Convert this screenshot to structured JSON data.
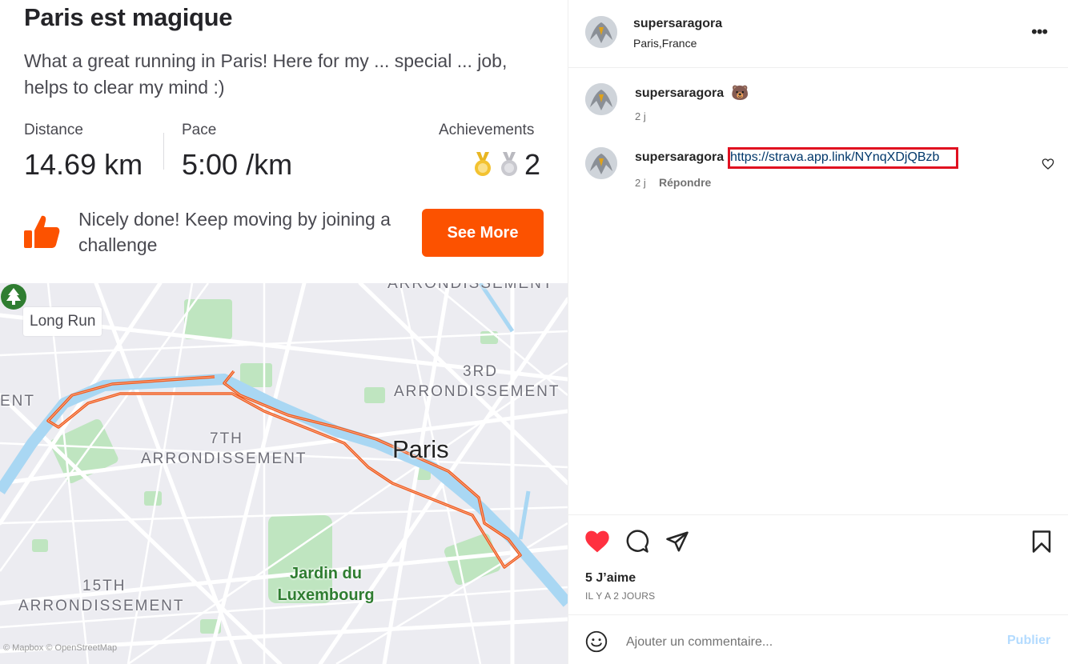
{
  "activity": {
    "title": "Paris est magique",
    "description": "What a great running in Paris! Here for my ... special ... job, helps to clear my mind :)",
    "stats": {
      "distance_label": "Distance",
      "distance_value": "14.69 km",
      "pace_label": "Pace",
      "pace_value": "5:00 /km",
      "achievements_label": "Achievements",
      "achievements_count": "2"
    },
    "promo_text": "Nicely done! Keep moving by joining a challenge",
    "see_more_label": "See More",
    "accent_color": "#fc5200"
  },
  "map": {
    "badge": "Long Run",
    "labels": {
      "arr_top": "ARRONDISSEMENT",
      "arr3_num": "3RD",
      "arr3": "ARRONDISSEMENT",
      "arr_left": "ENT",
      "arr7_num": "7TH",
      "arr7": "ARRONDISSEMENT",
      "arr15_num": "15TH",
      "arr15": "ARRONDISSEMENT",
      "city": "Paris",
      "park": "Jardin du Luxembourg"
    },
    "attribution": "© Mapbox © OpenStreetMap"
  },
  "post": {
    "author": "supersaragora",
    "location": "Paris,France",
    "comments": [
      {
        "username": "supersaragora",
        "emoji": "🐻",
        "time": "2 j"
      },
      {
        "username": "supersaragora",
        "link": "https://strava.app.link/NYnqXDjQBzb",
        "time": "2 j",
        "reply": "Répondre"
      }
    ],
    "likes": "5 J’aime",
    "posted_ago": "IL Y A 2 JOURS",
    "comment_placeholder": "Ajouter un commentaire...",
    "publish_label": "Publier",
    "like_color": "#ff3040"
  }
}
